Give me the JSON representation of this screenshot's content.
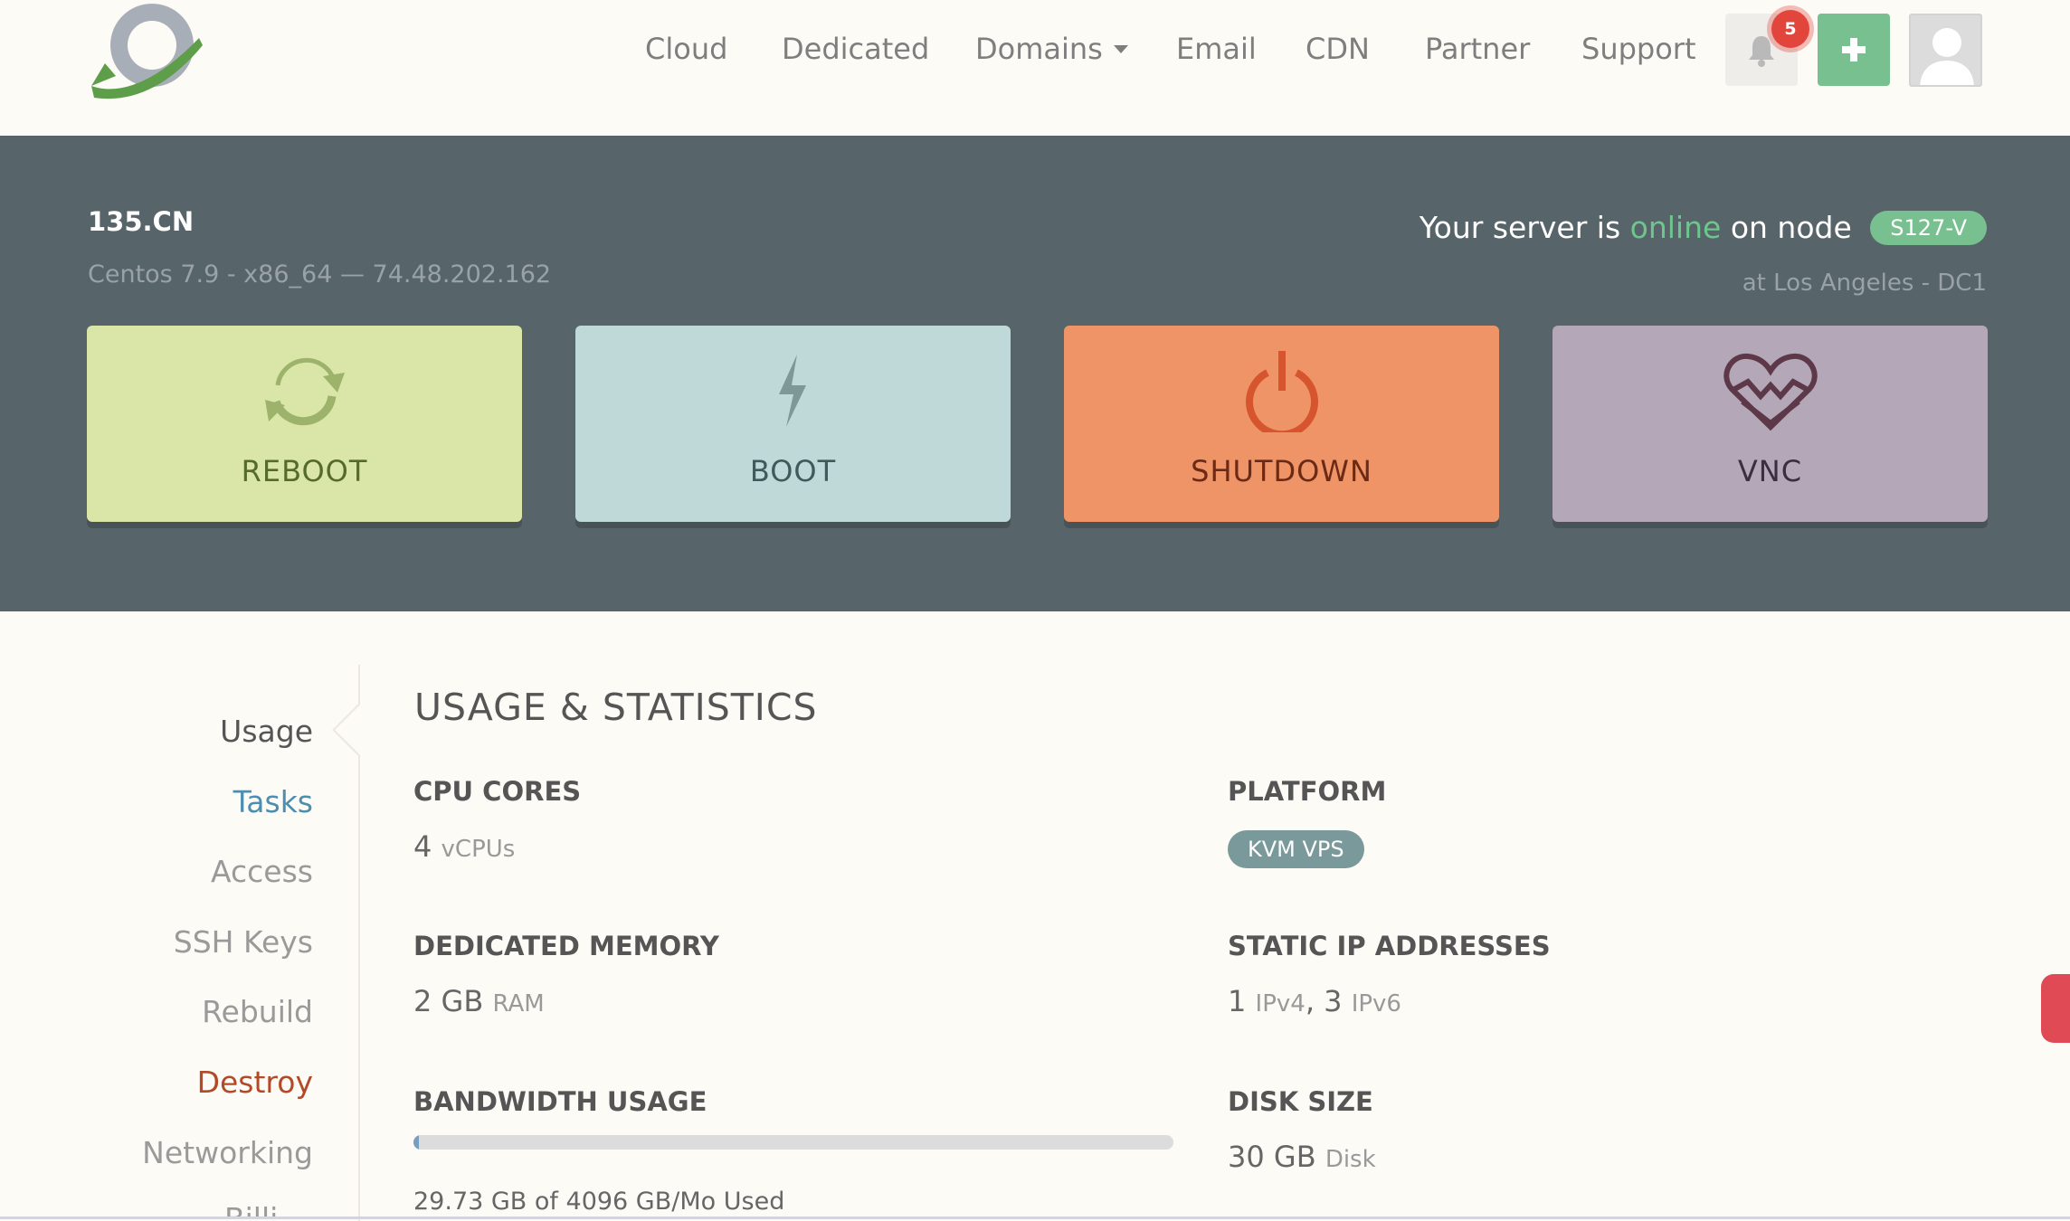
{
  "nav": {
    "items": [
      "Cloud",
      "Dedicated",
      "Domains",
      "Email",
      "CDN",
      "Partner",
      "Support"
    ],
    "notification_count": "5"
  },
  "server": {
    "name": "135.CN",
    "subtitle": "Centos 7.9 - x86_64 — 74.48.202.162",
    "status_prefix": "Your server is",
    "status_word": "online",
    "status_suffix": "on node",
    "node": "S127-V",
    "location": "at Los Angeles - DC1"
  },
  "actions": {
    "reboot": "REBOOT",
    "boot": "BOOT",
    "shutdown": "SHUTDOWN",
    "vnc": "VNC"
  },
  "sidebar": {
    "items": [
      "Usage",
      "Tasks",
      "Access",
      "SSH Keys",
      "Rebuild",
      "Destroy",
      "Networking",
      "Billi"
    ],
    "active": "Usage"
  },
  "main": {
    "title": "USAGE & STATISTICS",
    "cpu": {
      "label": "CPU CORES",
      "value": "4",
      "unit": "vCPUs"
    },
    "platform": {
      "label": "PLATFORM",
      "badge": "KVM VPS"
    },
    "memory": {
      "label": "DEDICATED MEMORY",
      "value": "2 GB",
      "unit": "RAM"
    },
    "ip": {
      "label": "STATIC IP ADDRESSES",
      "v4_count": "1",
      "v4_unit": "IPv4",
      "sep": ",",
      "v6_count": "3",
      "v6_unit": "IPv6"
    },
    "bandwidth": {
      "label": "BANDWIDTH USAGE",
      "used_text": "29.73 GB of 4096 GB/Mo Used",
      "fraction_used": 0.0073
    },
    "disk": {
      "label": "DISK SIZE",
      "value": "30 GB",
      "unit": "Disk"
    }
  },
  "colors": {
    "accent_green": "#78c08f",
    "online_green": "#6fc58e",
    "hero_bg": "#576469",
    "reboot": "#d9e6a8",
    "boot": "#bed9d8",
    "shutdown": "#ef9467",
    "vnc": "#b4a7b7",
    "destroy": "#b24a28",
    "tasks": "#4c8eb0"
  },
  "icons": [
    "logo",
    "bell-icon",
    "plus-icon",
    "user-icon",
    "refresh-icon",
    "lightning-icon",
    "power-icon",
    "heart-pulse-icon"
  ]
}
